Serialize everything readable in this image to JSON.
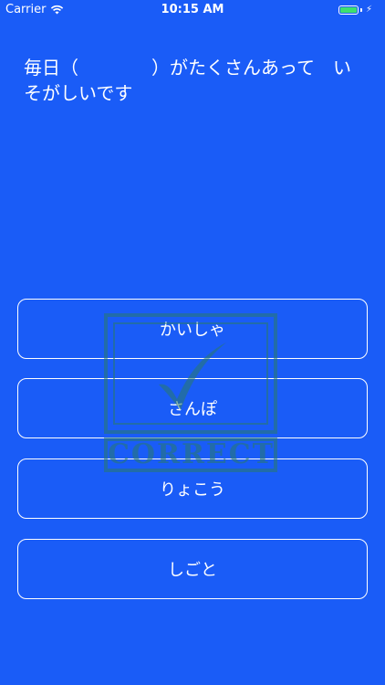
{
  "status_bar": {
    "carrier": "Carrier",
    "time": "10:15 AM",
    "battery_color": "#3ee06d"
  },
  "question": {
    "text": "毎日（　　　　）がたくさんあって　いそがしいです"
  },
  "stamp": {
    "icon": "checkmark-icon",
    "text": "CORRECT",
    "color": "#2a7a6a"
  },
  "answers": [
    {
      "label": "かいしゃ"
    },
    {
      "label": "さんぽ"
    },
    {
      "label": "りょこう"
    },
    {
      "label": "しごと"
    }
  ],
  "colors": {
    "background": "#1a5cf7",
    "foreground": "#ffffff"
  }
}
